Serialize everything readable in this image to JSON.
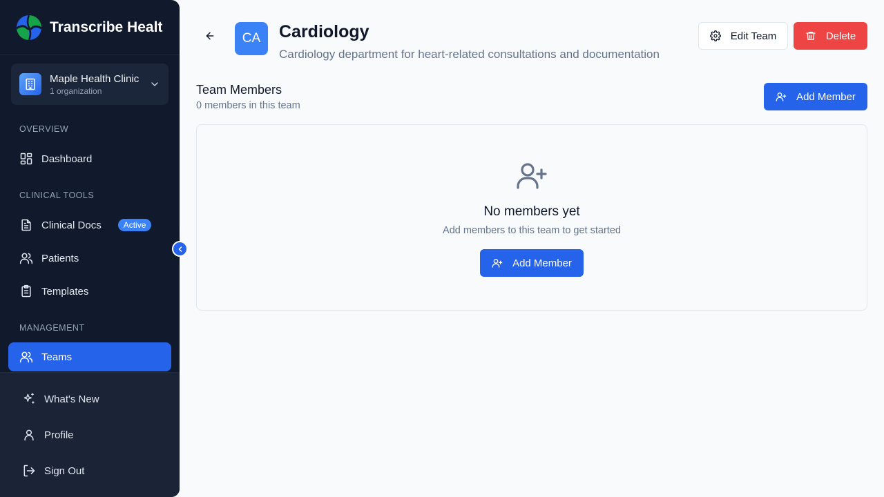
{
  "app": {
    "title": "Transcribe Healt"
  },
  "organization": {
    "name": "Maple Health Clinic",
    "subtitle": "1 organization"
  },
  "sidebar": {
    "sections": {
      "overview": "OVERVIEW",
      "clinical_tools": "CLINICAL TOOLS",
      "management": "MANAGEMENT"
    },
    "items": {
      "dashboard": "Dashboard",
      "clinical_docs": "Clinical Docs",
      "clinical_docs_badge": "Active",
      "patients": "Patients",
      "templates": "Templates",
      "teams": "Teams"
    },
    "bottom": {
      "whats_new": "What's New",
      "profile": "Profile",
      "sign_out": "Sign Out"
    }
  },
  "team": {
    "initials": "CA",
    "name": "Cardiology",
    "description": "Cardiology department for heart-related consultations and documentation",
    "edit_label": "Edit Team",
    "delete_label": "Delete"
  },
  "members": {
    "title": "Team Members",
    "count_text": "0 members in this team",
    "add_label": "Add Member",
    "empty_title": "No members yet",
    "empty_subtitle": "Add members to this team to get started",
    "empty_add_label": "Add Member"
  },
  "colors": {
    "sidebar_bg": "#111a2c",
    "accent": "#2563eb",
    "danger": "#ef4444",
    "page_bg": "#f8fafc"
  },
  "icons": {
    "logo": "globe-logo-icon",
    "org": "building-icon",
    "dashboard": "grid-icon",
    "clinical_docs": "document-icon",
    "patients": "users-icon",
    "templates": "clipboard-icon",
    "teams": "users-icon",
    "whats_new": "sparkles-icon",
    "profile": "user-icon",
    "sign_out": "logout-icon",
    "edit": "gear-icon",
    "delete": "trash-icon",
    "add_member": "user-plus-icon",
    "back": "arrow-left-icon",
    "collapse": "chevron-left-icon"
  }
}
